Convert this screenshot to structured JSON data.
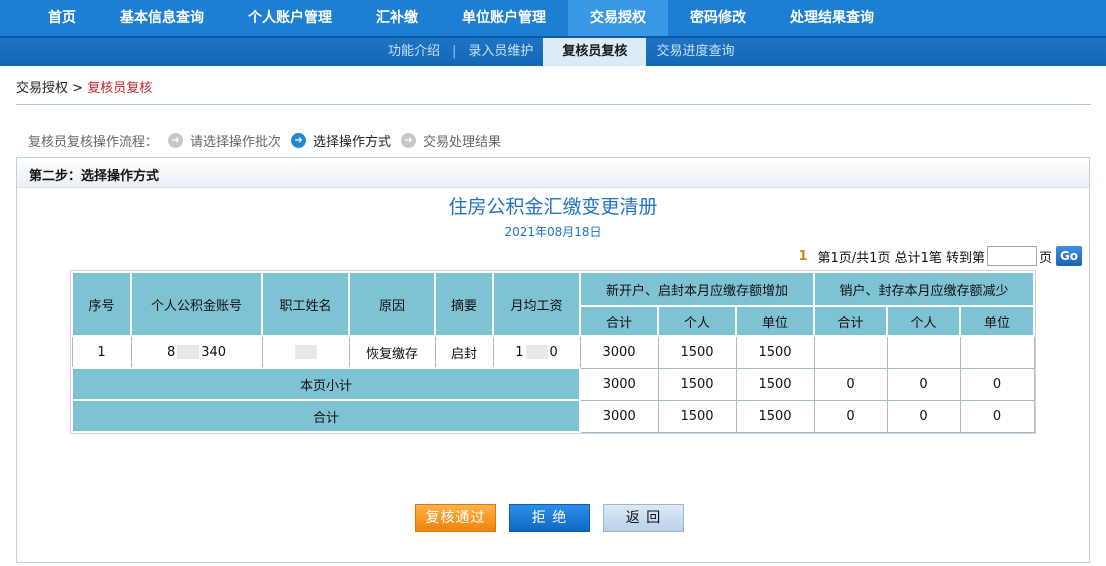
{
  "topnav": {
    "items": [
      {
        "label": "首页"
      },
      {
        "label": "基本信息查询"
      },
      {
        "label": "个人账户管理"
      },
      {
        "label": "汇补缴"
      },
      {
        "label": "单位账户管理"
      },
      {
        "label": "交易授权"
      },
      {
        "label": "密码修改"
      },
      {
        "label": "处理结果查询"
      }
    ],
    "active_index": 5
  },
  "subnav": {
    "items": [
      {
        "label": "功能介绍"
      },
      {
        "label": "录入员维护"
      },
      {
        "label": "复核员复核"
      },
      {
        "label": "交易进度查询"
      }
    ],
    "separator": "|",
    "active_index": 2
  },
  "breadcrumb": {
    "parent": "交易授权",
    "sep": " > ",
    "current": "复核员复核"
  },
  "steps": {
    "prefix": "复核员复核操作流程：",
    "items": [
      {
        "label": "请选择操作批次",
        "active": false
      },
      {
        "label": "选择操作方式",
        "active": true
      },
      {
        "label": "交易处理结果",
        "active": false
      }
    ]
  },
  "panel": {
    "title": "第二步：选择操作方式"
  },
  "document": {
    "title": "住房公积金汇缴变更清册",
    "date": "2021年08月18日"
  },
  "pager": {
    "current": "1",
    "info": "第1页/共1页 总计1笔 转到第",
    "input_value": "",
    "suffix": "页",
    "go_label": "Go"
  },
  "table": {
    "headers": {
      "seq": "序号",
      "account": "个人公积金账号",
      "name": "职工姓名",
      "reason": "原因",
      "summary": "摘要",
      "salary": "月均工资",
      "increase_group": "新开户、启封本月应缴存额增加",
      "decrease_group": "销户、封存本月应缴存额减少",
      "sub": [
        "合计",
        "个人",
        "单位",
        "合计",
        "个人",
        "单位"
      ]
    },
    "row": {
      "seq": "1",
      "account_prefix": "8",
      "account_suffix": "340",
      "name_prefix": "",
      "reason": "恢复缴存",
      "summary": "启封",
      "salary_prefix": "1",
      "salary_suffix": "0",
      "inc_total": "3000",
      "inc_personal": "1500",
      "inc_unit": "1500",
      "dec_total": "",
      "dec_personal": "",
      "dec_unit": ""
    },
    "subtotal": {
      "label": "本页小计",
      "values": [
        "3000",
        "1500",
        "1500",
        "0",
        "0",
        "0"
      ]
    },
    "total": {
      "label": "合计",
      "values": [
        "3000",
        "1500",
        "1500",
        "0",
        "0",
        "0"
      ]
    }
  },
  "buttons": {
    "approve": "复核通过",
    "reject": "拒 绝",
    "back": "返 回"
  }
}
